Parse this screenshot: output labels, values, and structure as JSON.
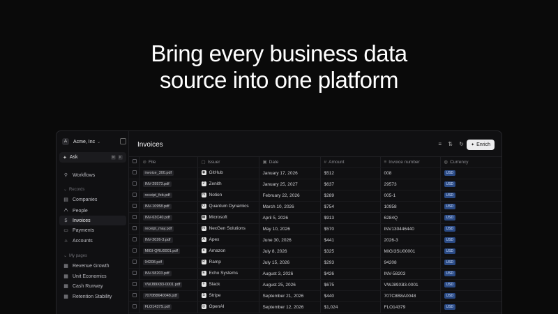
{
  "hero": {
    "line1": "Bring every business data",
    "line2": "source into one platform"
  },
  "workspace": {
    "logo": "A",
    "name": "Acme, Inc",
    "chevron": "⌄"
  },
  "ask": {
    "label": "Ask",
    "kbd1": "⌘",
    "kbd2": "K"
  },
  "sidebar": {
    "workflows": "Workflows",
    "records_group": "Records",
    "records": [
      "Companies",
      "People",
      "Invoices",
      "Payments",
      "Accounts"
    ],
    "active": "Invoices",
    "pages_group": "My pages",
    "pages": [
      "Revenue Growth",
      "Unit Economics",
      "Cash Runway",
      "Retention Stability"
    ]
  },
  "main": {
    "title": "Invoices",
    "enrich_label": "Enrich"
  },
  "table": {
    "headers": [
      "File",
      "Issuer",
      "Date",
      "Amount",
      "Invoice number",
      "Currency"
    ],
    "rows": [
      {
        "file": "invoice_300.pdf",
        "issuer": "GitHub",
        "logo": "◉",
        "date": "January 17, 2026",
        "amount": "$512",
        "number": "008",
        "currency": "USD"
      },
      {
        "file": "INV-29573.pdf",
        "issuer": "Zenith",
        "logo": "Z",
        "date": "January 25, 2027",
        "amount": "$637",
        "number": "29573",
        "currency": "USD"
      },
      {
        "file": "receipt_feb.pdf",
        "issuer": "Notion",
        "logo": "N",
        "date": "February 22, 2026",
        "amount": "$289",
        "number": "005-1",
        "currency": "USD"
      },
      {
        "file": "INV-10958.pdf",
        "issuer": "Quantum Dynamics",
        "logo": "Q",
        "date": "March 10, 2026",
        "amount": "$754",
        "number": "10958",
        "currency": "USD"
      },
      {
        "file": "INV-63C40.pdf",
        "issuer": "Microsoft",
        "logo": "▦",
        "date": "April 5, 2026",
        "amount": "$913",
        "number": "6284Q",
        "currency": "USD"
      },
      {
        "file": "receipt_may.pdf",
        "issuer": "NexGen Solutions",
        "logo": "N",
        "date": "May 10, 2026",
        "amount": "$570",
        "number": "INV130446440",
        "currency": "USD"
      },
      {
        "file": "INV-2026-3.pdf",
        "issuer": "Apex",
        "logo": "A",
        "date": "June 30, 2026",
        "amount": "$441",
        "number": "2026-3",
        "currency": "USD"
      },
      {
        "file": "MIGI-QRU0001.pdf",
        "issuer": "Amazon",
        "logo": "a",
        "date": "July 8, 2026",
        "amount": "$325",
        "number": "MIGI3SU00001",
        "currency": "USD"
      },
      {
        "file": "94208.pdf",
        "issuer": "Ramp",
        "logo": "R",
        "date": "July 15, 2026",
        "amount": "$293",
        "number": "94208",
        "currency": "USD"
      },
      {
        "file": "INV-58203.pdf",
        "issuer": "Echo Systems",
        "logo": "E",
        "date": "August 3, 2026",
        "amount": "$426",
        "number": "INV-58203",
        "currency": "USD"
      },
      {
        "file": "VWJ89X83-0001.pdf",
        "issuer": "Slack",
        "logo": "#",
        "date": "August 25, 2026",
        "amount": "$675",
        "number": "VWJ89X83-0001",
        "currency": "USD"
      },
      {
        "file": "7070B8640048.pdf",
        "issuer": "Stripe",
        "logo": "S",
        "date": "September 21, 2026",
        "amount": "$440",
        "number": "707C8B8A0048",
        "currency": "USD"
      },
      {
        "file": "FLO1437S.pdf",
        "issuer": "OpenAI",
        "logo": "◎",
        "date": "September 12, 2026",
        "amount": "$1,024",
        "number": "FLO14379",
        "currency": "USD"
      }
    ]
  },
  "colors": {
    "accent_badge": "#2a4a85",
    "background": "#0a0a0a"
  }
}
